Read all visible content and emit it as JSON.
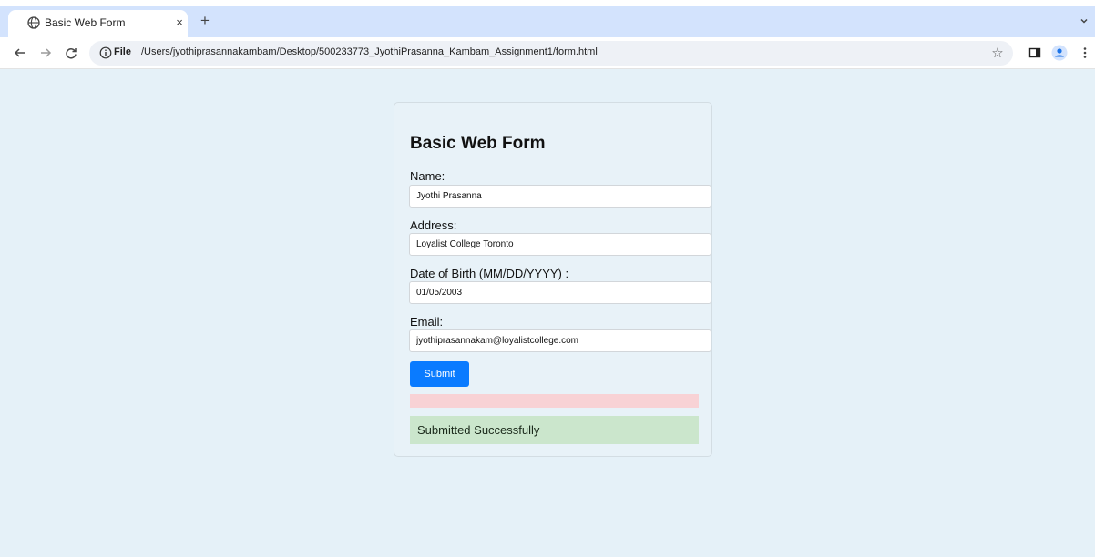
{
  "browser": {
    "tab_title": "Basic Web Form",
    "tab_close": "×",
    "new_tab": "+",
    "url_scheme_label": "File",
    "url": "/Users/jyothiprasannakambam/Desktop/500233773_JyothiPrasanna_Kambam_Assignment1/form.html",
    "icons": {
      "tab_favicon": "globe-icon",
      "tab_search": "chevron-down-icon",
      "back": "back-arrow-icon",
      "forward": "forward-arrow-icon",
      "reload": "reload-icon",
      "site_info": "info-icon",
      "bookmark": "star-icon",
      "side_panel": "side-panel-icon",
      "profile": "profile-icon",
      "menu": "kebab-menu-icon"
    },
    "colors": {
      "tab_strip": "#d3e3fd",
      "profile_accent": "#1a73e8"
    }
  },
  "form": {
    "title": "Basic Web Form",
    "fields": [
      {
        "label": "Name:",
        "value": "Jyothi Prasanna"
      },
      {
        "label": "Address:",
        "value": "Loyalist College Toronto"
      },
      {
        "label": "Date of Birth (MM/DD/YYYY) :",
        "value": "01/05/2003"
      },
      {
        "label": "Email:",
        "value": "jyothiprasannakam@loyalistcollege.com"
      }
    ],
    "submit_label": "Submit",
    "error_message": "",
    "success_message": "Submitted Successfully",
    "colors": {
      "page_background": "#e5f1f8",
      "submit_button": "#0a7bff",
      "error_background": "#f8d2d5",
      "success_background": "#cbe6cc"
    }
  }
}
